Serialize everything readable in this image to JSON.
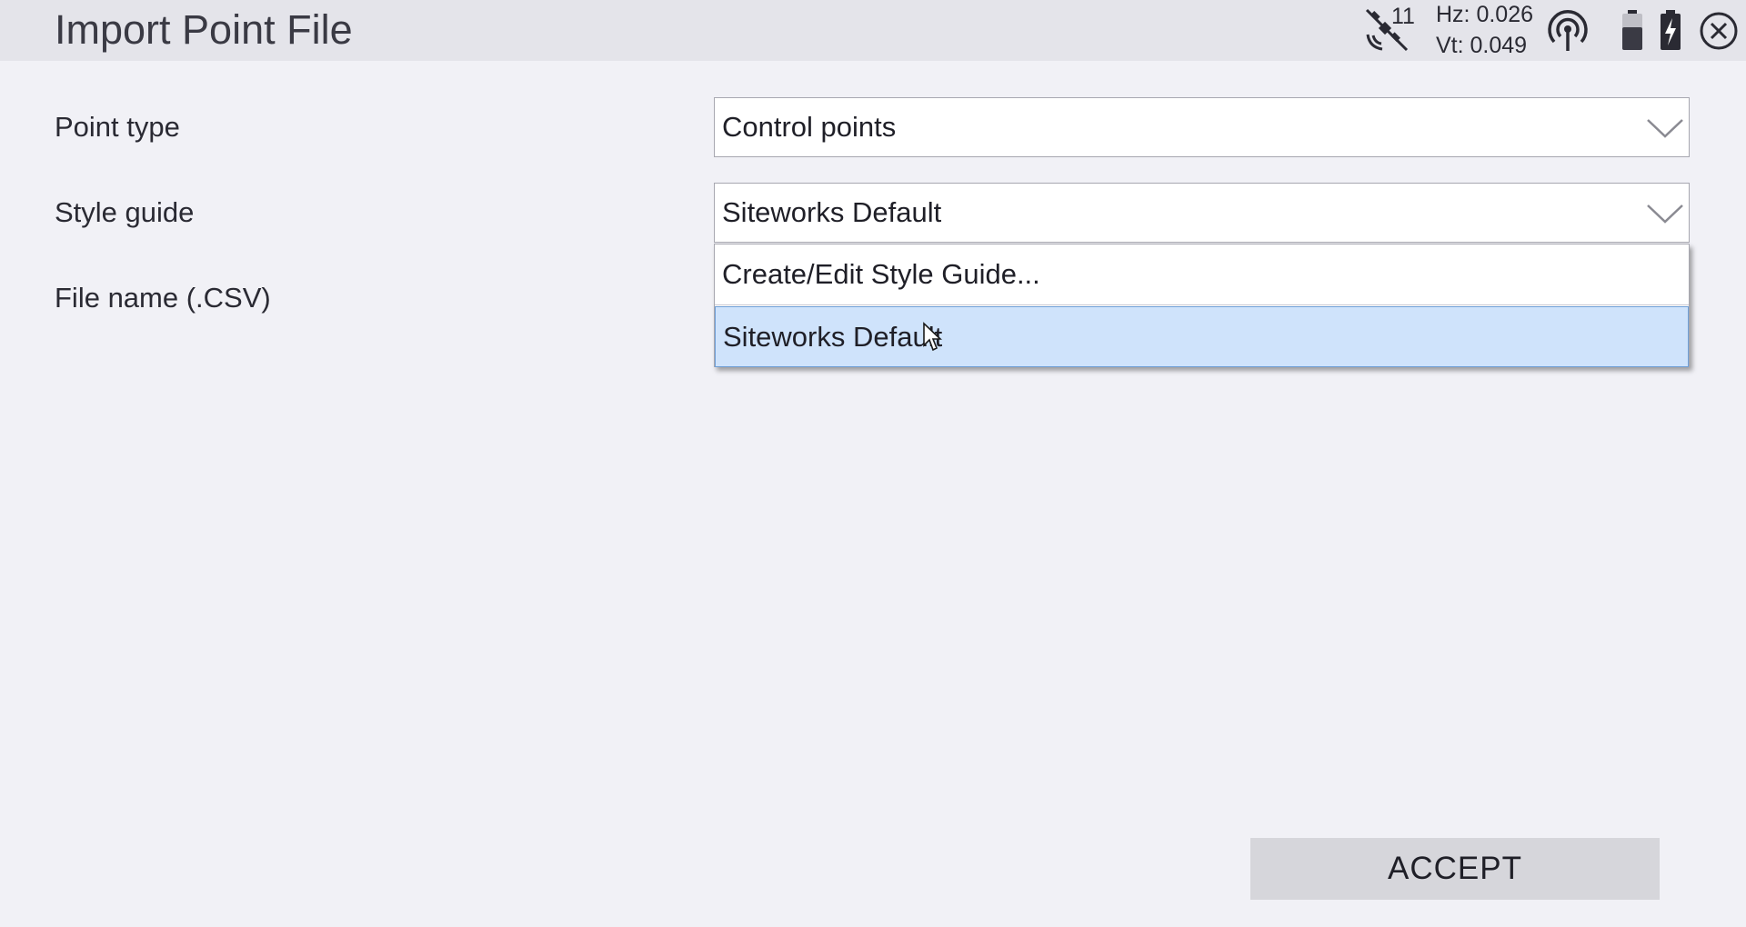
{
  "header": {
    "title": "Import Point File",
    "satellite_count": "11",
    "hz": "Hz: 0.026",
    "vt": "Vt: 0.049",
    "icons": [
      "satellite-icon",
      "radio-signal-icon",
      "battery-icon",
      "battery-charging-icon",
      "close-icon"
    ]
  },
  "form": {
    "point_type": {
      "label": "Point type",
      "value": "Control points"
    },
    "style_guide": {
      "label": "Style guide",
      "value": "Siteworks Default",
      "options": [
        "Create/Edit Style Guide...",
        "Siteworks Default"
      ],
      "selected_option": "Siteworks Default"
    },
    "file_name": {
      "label": "File name (.CSV)"
    }
  },
  "actions": {
    "accept_label": "ACCEPT"
  },
  "colors": {
    "header_bg": "#e4e4ea",
    "page_bg": "#f1f1f6",
    "selected_bg": "#cfe3fb",
    "button_bg": "#d6d6db"
  }
}
